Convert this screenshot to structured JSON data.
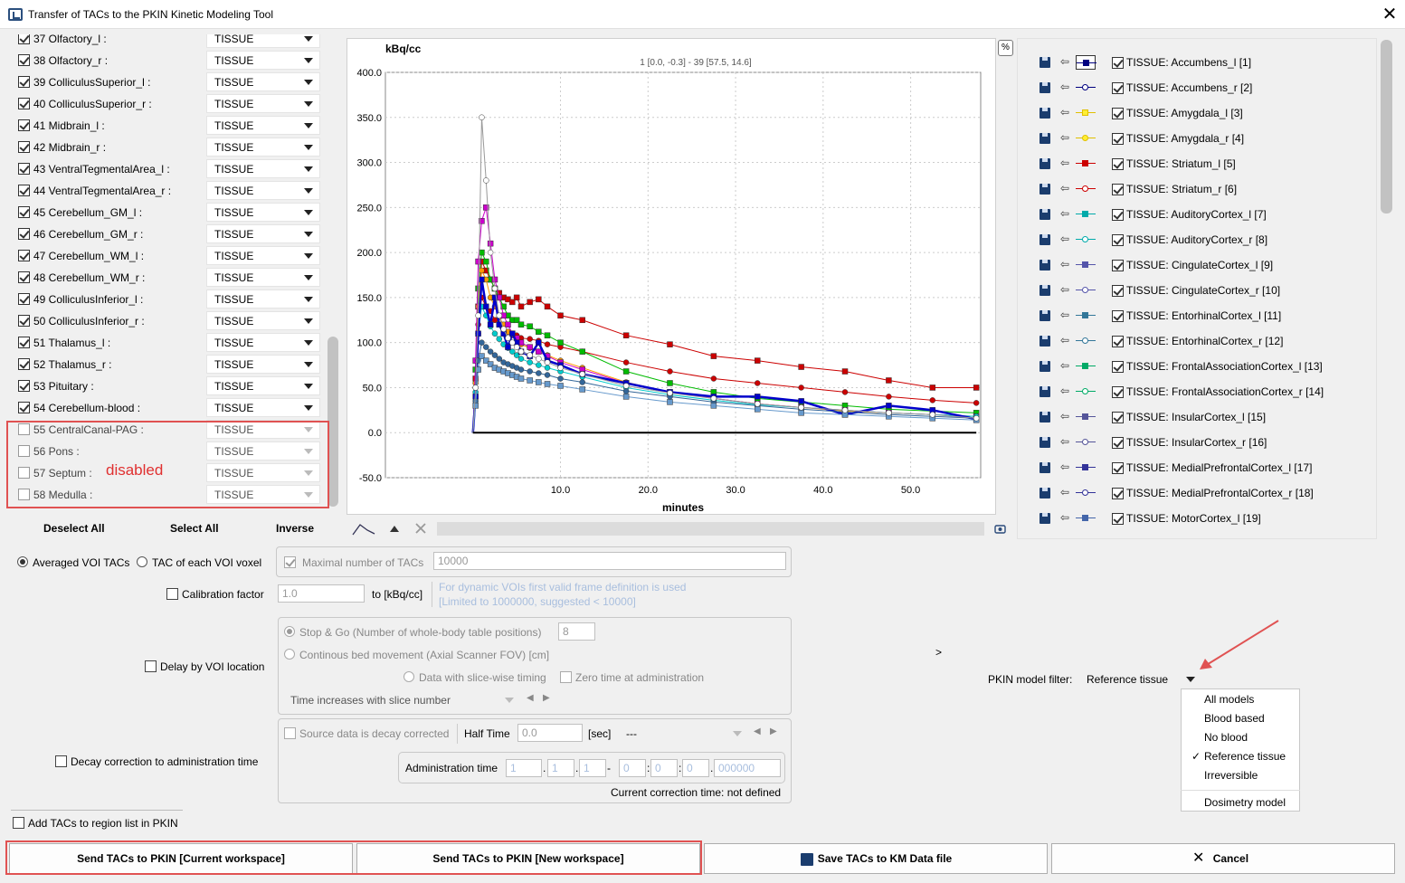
{
  "window": {
    "title": "Transfer of TACs to the PKIN Kinetic Modeling Tool"
  },
  "region_list": {
    "rows": [
      {
        "label": "37 Olfactory_l :",
        "type": "TISSUE",
        "checked": true,
        "enabled": true
      },
      {
        "label": "38 Olfactory_r :",
        "type": "TISSUE",
        "checked": true,
        "enabled": true
      },
      {
        "label": "39 ColliculusSuperior_l :",
        "type": "TISSUE",
        "checked": true,
        "enabled": true
      },
      {
        "label": "40 ColliculusSuperior_r :",
        "type": "TISSUE",
        "checked": true,
        "enabled": true
      },
      {
        "label": "41 Midbrain_l :",
        "type": "TISSUE",
        "checked": true,
        "enabled": true
      },
      {
        "label": "42 Midbrain_r :",
        "type": "TISSUE",
        "checked": true,
        "enabled": true
      },
      {
        "label": "43 VentralTegmentalArea_l :",
        "type": "TISSUE",
        "checked": true,
        "enabled": true
      },
      {
        "label": "44 VentralTegmentalArea_r :",
        "type": "TISSUE",
        "checked": true,
        "enabled": true
      },
      {
        "label": "45 Cerebellum_GM_l :",
        "type": "TISSUE",
        "checked": true,
        "enabled": true
      },
      {
        "label": "46 Cerebellum_GM_r :",
        "type": "TISSUE",
        "checked": true,
        "enabled": true
      },
      {
        "label": "47 Cerebellum_WM_l :",
        "type": "TISSUE",
        "checked": true,
        "enabled": true
      },
      {
        "label": "48 Cerebellum_WM_r :",
        "type": "TISSUE",
        "checked": true,
        "enabled": true
      },
      {
        "label": "49 ColliculusInferior_l :",
        "type": "TISSUE",
        "checked": true,
        "enabled": true
      },
      {
        "label": "50 ColliculusInferior_r :",
        "type": "TISSUE",
        "checked": true,
        "enabled": true
      },
      {
        "label": "51 Thalamus_l :",
        "type": "TISSUE",
        "checked": true,
        "enabled": true
      },
      {
        "label": "52 Thalamus_r :",
        "type": "TISSUE",
        "checked": true,
        "enabled": true
      },
      {
        "label": "53 Pituitary :",
        "type": "TISSUE",
        "checked": true,
        "enabled": true
      },
      {
        "label": "54 Cerebellum-blood :",
        "type": "TISSUE",
        "checked": true,
        "enabled": true
      },
      {
        "label": "55 CentralCanal-PAG :",
        "type": "TISSUE",
        "checked": false,
        "enabled": false
      },
      {
        "label": "56 Pons :",
        "type": "TISSUE",
        "checked": false,
        "enabled": false
      },
      {
        "label": "57 Septum :",
        "type": "TISSUE",
        "checked": false,
        "enabled": false
      },
      {
        "label": "58 Medulla :",
        "type": "TISSUE",
        "checked": false,
        "enabled": false
      }
    ],
    "annotation": "disabled",
    "buttons": {
      "deselect_all": "Deselect All",
      "select_all": "Select All",
      "inverse": "Inverse"
    }
  },
  "chart_data": {
    "type": "line",
    "ylabel": "kBq/cc",
    "xlabel": "minutes",
    "subtitle": "1 [0.0, -0.3] - 39 [57.5, 14.6]",
    "xlim": [
      -10.0,
      58.0
    ],
    "ylim": [
      -50.0,
      400.0
    ],
    "xticks": [
      "10.0",
      "20.0",
      "30.0",
      "40.0",
      "50.0"
    ],
    "yticks": [
      "400.0",
      "350.0",
      "300.0",
      "250.0",
      "200.0",
      "150.0",
      "100.0",
      "50.0",
      "0.0",
      "-50.0"
    ],
    "grid": true,
    "frame_times": [
      0.0,
      0.3,
      0.6,
      1.0,
      1.5,
      2.0,
      2.5,
      3.0,
      3.5,
      4.0,
      4.5,
      5.0,
      5.5,
      6.5,
      7.5,
      8.5,
      10.0,
      12.5,
      17.5,
      22.5,
      27.5,
      32.5,
      37.5,
      42.5,
      47.5,
      52.5,
      57.5
    ],
    "series": [
      {
        "color": "#cc0000",
        "values": [
          0,
          60,
          140,
          190,
          180,
          170,
          160,
          155,
          150,
          148,
          145,
          150,
          140,
          145,
          148,
          140,
          130,
          125,
          108,
          98,
          85,
          80,
          73,
          68,
          58,
          50,
          50
        ]
      },
      {
        "color": "#cc0000",
        "values": [
          0,
          50,
          120,
          150,
          140,
          135,
          125,
          120,
          115,
          112,
          110,
          108,
          105,
          104,
          102,
          98,
          95,
          90,
          78,
          68,
          60,
          55,
          50,
          45,
          40,
          36,
          33
        ]
      },
      {
        "color": "#00bb00",
        "values": [
          0,
          70,
          160,
          200,
          190,
          170,
          160,
          150,
          140,
          130,
          125,
          125,
          120,
          118,
          112,
          108,
          100,
          90,
          68,
          55,
          45,
          38,
          34,
          30,
          26,
          24,
          22
        ]
      },
      {
        "color": "#ff9900",
        "values": [
          0,
          55,
          140,
          180,
          170,
          150,
          140,
          128,
          120,
          112,
          108,
          104,
          98,
          94,
          90,
          86,
          80,
          72,
          56,
          45,
          38,
          32,
          28,
          24,
          22,
          20,
          18
        ]
      },
      {
        "color": "#cc00cc",
        "values": [
          0,
          80,
          190,
          235,
          250,
          210,
          170,
          150,
          130,
          120,
          110,
          105,
          100,
          95,
          90,
          85,
          78,
          70,
          55,
          45,
          38,
          32,
          28,
          25,
          22,
          20,
          18
        ]
      },
      {
        "color": "#00cccc",
        "values": [
          0,
          45,
          110,
          140,
          130,
          118,
          110,
          104,
          98,
          94,
          90,
          86,
          82,
          78,
          75,
          72,
          68,
          62,
          50,
          42,
          36,
          31,
          28,
          25,
          22,
          20,
          18
        ]
      },
      {
        "color": "#0000cc",
        "values": [
          0,
          40,
          110,
          170,
          140,
          120,
          150,
          120,
          110,
          95,
          110,
          100,
          90,
          85,
          100,
          80,
          75,
          65,
          55,
          45,
          40,
          40,
          35,
          20,
          30,
          25,
          15
        ]
      },
      {
        "color": "#336699",
        "values": [
          0,
          35,
          80,
          100,
          95,
          90,
          86,
          82,
          78,
          76,
          74,
          72,
          70,
          68,
          66,
          64,
          60,
          56,
          46,
          40,
          34,
          30,
          26,
          23,
          20,
          18,
          16
        ]
      },
      {
        "color": "#6699cc",
        "values": [
          0,
          30,
          70,
          85,
          80,
          76,
          72,
          70,
          68,
          66,
          64,
          62,
          60,
          58,
          56,
          54,
          52,
          48,
          40,
          34,
          30,
          26,
          22,
          20,
          18,
          16,
          14
        ]
      },
      {
        "color": "#999999",
        "values": [
          0,
          50,
          130,
          350,
          280,
          200,
          160,
          130,
          115,
          105,
          100,
          95,
          90,
          86,
          82,
          78,
          72,
          65,
          52,
          44,
          38,
          32,
          28,
          25,
          22,
          20,
          16
        ]
      },
      {
        "color": "#000000",
        "values": [
          0,
          0,
          0,
          0,
          0,
          0,
          0,
          0,
          0,
          0,
          0,
          0,
          0,
          0,
          0,
          0,
          0,
          0,
          0,
          0,
          0,
          0,
          0,
          0,
          0,
          0,
          0
        ]
      }
    ]
  },
  "percent_button": "%",
  "tissues": [
    {
      "label": "TISSUE: Accumbens_l [1]",
      "color": "#000080",
      "marker": "square"
    },
    {
      "label": "TISSUE: Accumbens_r [2]",
      "color": "#000080",
      "marker": "circle"
    },
    {
      "label": "TISSUE: Amygdala_l [3]",
      "color": "#e0c000",
      "marker": "square"
    },
    {
      "label": "TISSUE: Amygdala_r [4]",
      "color": "#e0c000",
      "marker": "circle"
    },
    {
      "label": "TISSUE: Striatum_l [5]",
      "color": "#cc0000",
      "marker": "square"
    },
    {
      "label": "TISSUE: Striatum_r [6]",
      "color": "#cc0000",
      "marker": "circle"
    },
    {
      "label": "TISSUE: AuditoryCortex_l [7]",
      "color": "#00aaaa",
      "marker": "square"
    },
    {
      "label": "TISSUE: AuditoryCortex_r [8]",
      "color": "#00aaaa",
      "marker": "circle"
    },
    {
      "label": "TISSUE: CingulateCortex_l [9]",
      "color": "#5555aa",
      "marker": "square"
    },
    {
      "label": "TISSUE: CingulateCortex_r [10]",
      "color": "#5555aa",
      "marker": "circle"
    },
    {
      "label": "TISSUE: EntorhinalCortex_l [11]",
      "color": "#337799",
      "marker": "square"
    },
    {
      "label": "TISSUE: EntorhinalCortex_r [12]",
      "color": "#337799",
      "marker": "circle"
    },
    {
      "label": "TISSUE: FrontalAssociationCortex_l [13]",
      "color": "#00aa66",
      "marker": "square"
    },
    {
      "label": "TISSUE: FrontalAssociationCortex_r [14]",
      "color": "#00aa66",
      "marker": "circle"
    },
    {
      "label": "TISSUE: InsularCortex_l [15]",
      "color": "#555599",
      "marker": "square"
    },
    {
      "label": "TISSUE: InsularCortex_r [16]",
      "color": "#555599",
      "marker": "circle"
    },
    {
      "label": "TISSUE: MedialPrefrontalCortex_l [17]",
      "color": "#333399",
      "marker": "square"
    },
    {
      "label": "TISSUE: MedialPrefrontalCortex_r [18]",
      "color": "#333399",
      "marker": "circle"
    },
    {
      "label": "TISSUE: MotorCortex_l [19]",
      "color": "#4466aa",
      "marker": "square"
    }
  ],
  "options": {
    "averaged_voi": "Averaged VOI TACs",
    "each_voxel": "TAC of each VOI voxel",
    "max_tacs_label": "Maximal number of TACs",
    "max_tacs_value": "10000",
    "calibration_label": "Calibration factor",
    "calibration_value": "1.0",
    "calibration_unit": "to [kBq/cc]",
    "calibration_hint1": "For dynamic VOIs first valid frame definition is used",
    "calibration_hint2": "[Limited to 1000000, suggested < 10000]",
    "delay_label": "Delay by VOI location",
    "stop_go": "Stop & Go (Number of whole-body table positions)",
    "stop_go_value": "8",
    "continuous": "Continous bed movement (Axial Scanner FOV) [cm]",
    "slice_timing": "Data with slice-wise timing",
    "zero_time": "Zero time at administration",
    "time_increases": "Time increases with slice number",
    "decay_label": "Decay correction to administration time",
    "source_decay": "Source data is decay corrected",
    "half_time_label": "Half Time",
    "half_time_value": "0.0",
    "half_time_unit": "[sec]",
    "isotope_value": "---",
    "admin_time_label": "Administration time",
    "admin_fields": [
      "1",
      "1",
      "1",
      "0",
      "0",
      "0",
      "000000"
    ],
    "admin_separators": [
      ".",
      ".",
      "-",
      ":",
      ":",
      "."
    ],
    "current_correction": "Current correction time:  not defined",
    "add_tacs": "Add TACs to region list in PKIN",
    "expand_arrow": ">"
  },
  "model_filter": {
    "label": "PKIN model filter:",
    "value": "Reference tissue",
    "items": [
      "All models",
      "Blood based",
      "No blood",
      "Reference tissue",
      "Irreversible",
      "Dosimetry model"
    ],
    "selected": "Reference tissue"
  },
  "buttons": {
    "send_current": "Send TACs to PKIN [Current workspace]",
    "send_new": "Send TACs to PKIN [New workspace]",
    "save": "Save TACs to KM Data file",
    "cancel": "Cancel"
  }
}
